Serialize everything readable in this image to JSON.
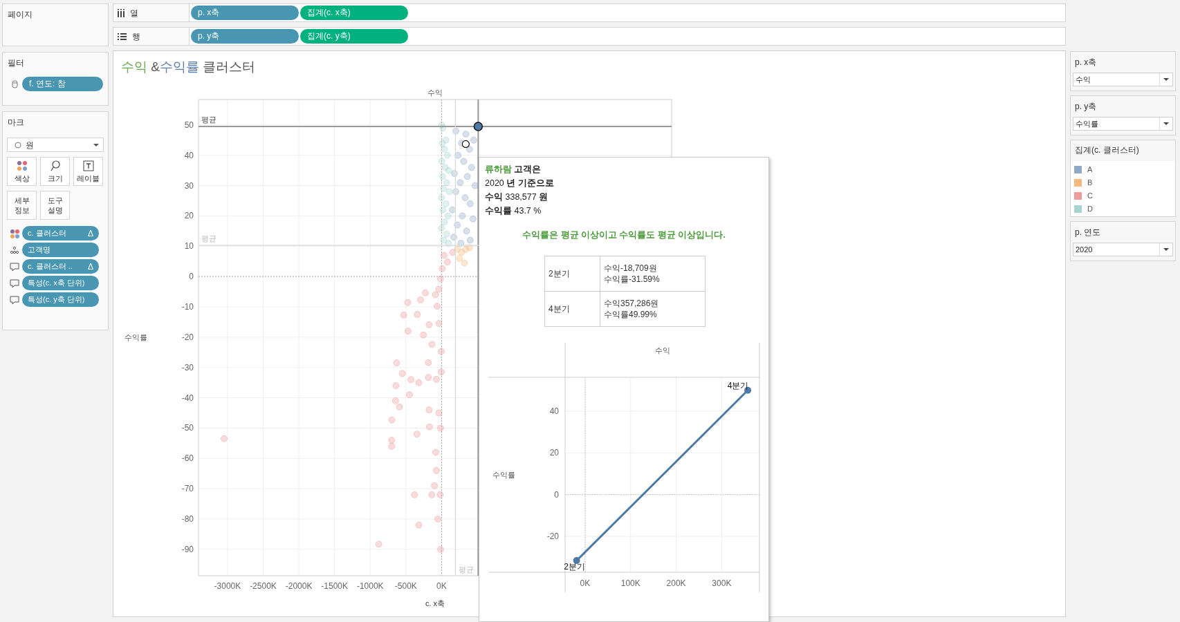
{
  "pages_card": {
    "title": "페이지"
  },
  "shelves": [
    {
      "kind": "columns",
      "label": "열",
      "pills": [
        {
          "text": "p. x축",
          "kind": "dimension"
        },
        {
          "text": "집계(c. x축)",
          "kind": "measure"
        }
      ]
    },
    {
      "kind": "rows",
      "label": "행",
      "pills": [
        {
          "text": "p. y축",
          "kind": "dimension"
        },
        {
          "text": "집계(c. y축)",
          "kind": "measure"
        }
      ]
    }
  ],
  "filters": {
    "title": "필터",
    "pills": [
      {
        "text": "f. 연도: 참"
      }
    ]
  },
  "marks": {
    "title": "마크",
    "mark_type": "원",
    "buttons": [
      {
        "label": "색상",
        "kind": "color"
      },
      {
        "label": "크기",
        "kind": "size"
      },
      {
        "label": "레이블",
        "kind": "label"
      },
      {
        "label": "세부 정보",
        "kind": "detail"
      },
      {
        "label": "도구 설명",
        "kind": "tooltip"
      }
    ],
    "fields": [
      {
        "kind": "color",
        "text": "c. 클러스터",
        "suffix": "Δ"
      },
      {
        "kind": "detail",
        "text": "고객명"
      },
      {
        "kind": "tooltip",
        "text": "c. 클러스터 ..",
        "suffix": "Δ"
      },
      {
        "kind": "tooltip",
        "text": "특성(c. x축 단위)"
      },
      {
        "kind": "tooltip",
        "text": "특성(c. y축 단위)"
      }
    ]
  },
  "view": {
    "title_parts": [
      {
        "text": "수익",
        "color": "#6aa84f"
      },
      {
        "text": " &",
        "color": "#555555"
      },
      {
        "text": "수익률",
        "color": "#5b7fa8"
      },
      {
        "text": " 클러스터",
        "color": "#555555"
      }
    ],
    "chart_data": {
      "type": "scatter",
      "title": "수익",
      "xlabel": "c. x축",
      "ylabel": "수익률",
      "xlim": [
        -3406,
        3223
      ],
      "ylim": [
        -98.7,
        58.4
      ],
      "xticks": [
        {
          "value": -3000,
          "label": "-3000K"
        },
        {
          "value": -2500,
          "label": "-2500K"
        },
        {
          "value": -2000,
          "label": "-2000K"
        },
        {
          "value": -1500,
          "label": "-1500K"
        },
        {
          "value": -1000,
          "label": "-1000K"
        },
        {
          "value": -500,
          "label": "-500K"
        },
        {
          "value": 0,
          "label": "0K"
        }
      ],
      "yticks": [
        -90,
        -80,
        -70,
        -60,
        -50,
        -40,
        -30,
        -20,
        -10,
        0,
        10,
        20,
        30,
        40,
        50
      ],
      "series": [
        {
          "color": "#8fa9c7",
          "marker": "circle",
          "x": [
            200,
            340,
            450,
            280,
            390,
            230,
            310,
            420,
            180,
            360,
            260,
            470,
            200,
            330,
            400,
            150,
            290,
            440,
            220,
            350,
            170,
            270,
            400
          ],
          "values": [
            48,
            47,
            45,
            44,
            42,
            40,
            38,
            36,
            34,
            33,
            31,
            30,
            28,
            26,
            24,
            22,
            20,
            19,
            17,
            15,
            13,
            11,
            12
          ]
        },
        {
          "color": "#f5b97f",
          "marker": "circle",
          "x": [
            220,
            280,
            340,
            250,
            320,
            390
          ],
          "values": [
            9,
            8,
            9,
            6,
            4.5,
            9.5
          ]
        },
        {
          "color": "#ec9c9b",
          "marker": "circle",
          "x": [
            -3047,
            -880,
            -697,
            -700,
            -700,
            -630,
            -640,
            -645,
            -590,
            -550,
            -530,
            -475,
            -470,
            -430,
            -450,
            -380,
            -345,
            -320,
            -320,
            -340,
            -295,
            -227,
            -255,
            -185,
            -185,
            -175,
            -175,
            -170,
            -135,
            -100,
            -82,
            -73,
            -73,
            -53,
            -38,
            -20,
            -14,
            -5,
            -5,
            -38,
            -63,
            -38,
            -15,
            10,
            82,
            155,
            35,
            -87,
            -135,
            -15
          ],
          "values": [
            -53.5,
            -88.3,
            -47.3,
            -54,
            -56,
            -28.5,
            -36,
            -41,
            -43,
            -32,
            -12.7,
            -8.6,
            -18,
            -34,
            -39,
            -72,
            -52,
            -82,
            -35,
            -12.5,
            -7.7,
            -5.4,
            -19.3,
            -28.4,
            -33.3,
            -15.9,
            -44,
            -49.6,
            -72,
            -69,
            -58,
            -33.9,
            -64,
            -80,
            -45,
            -72,
            -90,
            -31.5,
            -24.7,
            -15.5,
            -9.8,
            -4.2,
            -0.8,
            2.6,
            4.8,
            8,
            7,
            -6,
            -22.4,
            -50
          ]
        },
        {
          "color": "#a9d5d1",
          "marker": "circle",
          "x": [
            0,
            20,
            60,
            10,
            40,
            80,
            5,
            50,
            100,
            15,
            70,
            30,
            110,
            0,
            60,
            20,
            90,
            40,
            0,
            70,
            30,
            100
          ],
          "values": [
            50,
            49,
            45,
            44,
            42,
            40,
            38,
            36,
            35,
            33,
            31,
            29,
            28,
            26,
            24,
            22,
            20,
            18,
            16,
            14,
            12,
            11
          ]
        },
        {
          "color": "#4e79a7",
          "marker": "ringed_circle",
          "x": [
            513
          ],
          "values": [
            49.5
          ]
        },
        {
          "color": "#111111",
          "marker": "open_circle",
          "x": [
            338.577
          ],
          "values": [
            43.7
          ]
        }
      ],
      "grid": true,
      "ref_lines": [
        {
          "axis": "y",
          "value": 49.5,
          "label": "평균",
          "color": "#999999"
        },
        {
          "axis": "x",
          "value": 513,
          "color": "#999999"
        },
        {
          "axis": "y",
          "value": 10.3,
          "label": "평균",
          "color": "#dddddd"
        },
        {
          "axis": "x",
          "value": 193,
          "label": "평균",
          "color": "#dddddd"
        }
      ]
    }
  },
  "tooltip": {
    "customer": {
      "name": "류하람",
      "suffix": "고객은"
    },
    "lines": [
      "2020 **년 기준으로**",
      "**수익** 338,577 **원**",
      "**수익률** 43.7 %"
    ],
    "message": "수익률은 평균 이상이고 수익률도 평균 이상입니다.",
    "table": [
      {
        "quarter": "2분기",
        "lines": [
          "수익-18,709원",
          "수익률-31.59%"
        ]
      },
      {
        "quarter": "4분기",
        "lines": [
          "수익357,286원",
          "수익률49.99%"
        ]
      }
    ],
    "chart_data": {
      "type": "line",
      "title": "수익",
      "ylabel": "수익률",
      "x": [
        -18.709,
        357.286
      ],
      "xlim": [
        -44,
        383
      ],
      "ylim": [
        -37.2,
        56.2
      ],
      "xticks": [
        {
          "value": 0,
          "label": "0K"
        },
        {
          "value": 100,
          "label": "100K"
        },
        {
          "value": 200,
          "label": "200K"
        },
        {
          "value": 300,
          "label": "300K"
        }
      ],
      "yticks": [
        -20,
        0,
        20,
        40
      ],
      "grid": true,
      "series": [
        {
          "color": "#4e79a7",
          "marker": "circle",
          "values": [
            -31.6,
            50
          ]
        }
      ],
      "value_labels": [
        "2분기",
        "4분기"
      ]
    }
  },
  "right_panel": [
    {
      "kind": "parameter",
      "title": "p. x축",
      "value": "수익"
    },
    {
      "kind": "parameter",
      "title": "p. y축",
      "value": "수익률"
    },
    {
      "kind": "legend",
      "title": "집계(c. 클러스터)",
      "items": [
        {
          "label": "A",
          "color": "#8fa9c7"
        },
        {
          "label": "B",
          "color": "#f5b97f"
        },
        {
          "label": "C",
          "color": "#ec9c9b"
        },
        {
          "label": "D",
          "color": "#a9d5d1"
        }
      ]
    },
    {
      "kind": "parameter",
      "title": "p. 연도",
      "value": "2020"
    }
  ]
}
